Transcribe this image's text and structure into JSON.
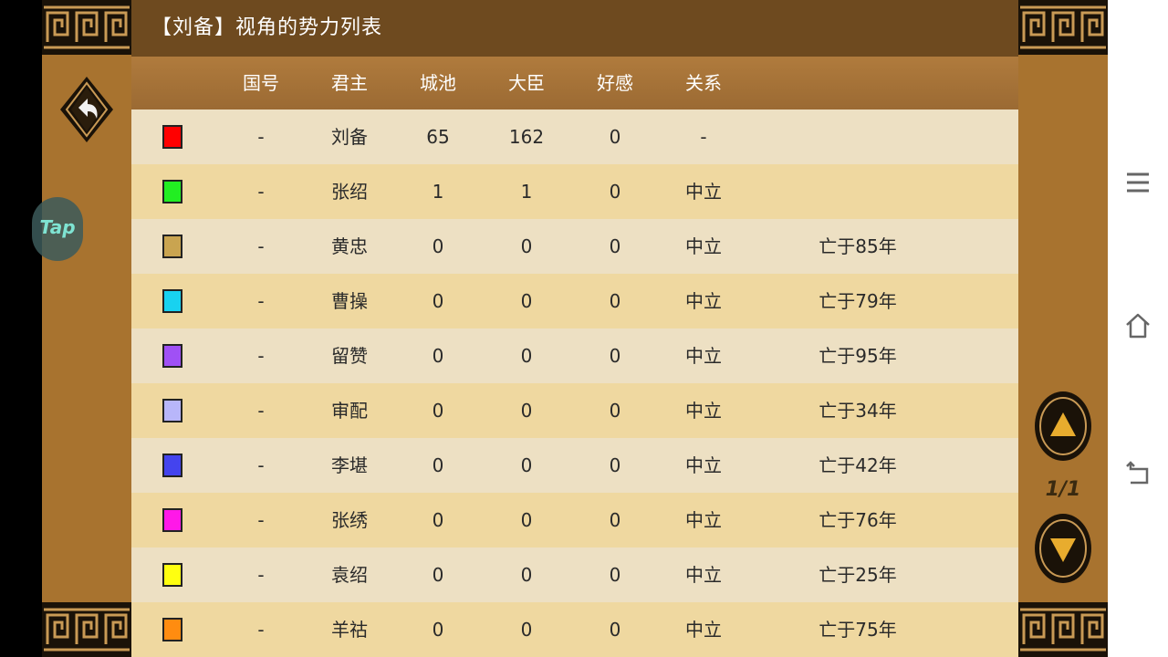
{
  "title": "【刘备】视角的势力列表",
  "columns": [
    "国号",
    "君主",
    "城池",
    "大臣",
    "好感",
    "关系"
  ],
  "rows": [
    {
      "color": "#ff0000",
      "country": "-",
      "ruler": "刘备",
      "cities": "65",
      "ministers": "162",
      "favor": "0",
      "relation": "-",
      "status": ""
    },
    {
      "color": "#22ee22",
      "country": "-",
      "ruler": "张绍",
      "cities": "1",
      "ministers": "1",
      "favor": "0",
      "relation": "中立",
      "status": ""
    },
    {
      "color": "#c9a450",
      "country": "-",
      "ruler": "黄忠",
      "cities": "0",
      "ministers": "0",
      "favor": "0",
      "relation": "中立",
      "status": "亡于85年"
    },
    {
      "color": "#18d2f0",
      "country": "-",
      "ruler": "曹操",
      "cities": "0",
      "ministers": "0",
      "favor": "0",
      "relation": "中立",
      "status": "亡于79年"
    },
    {
      "color": "#a050f5",
      "country": "-",
      "ruler": "留赞",
      "cities": "0",
      "ministers": "0",
      "favor": "0",
      "relation": "中立",
      "status": "亡于95年"
    },
    {
      "color": "#b8b6fa",
      "country": "-",
      "ruler": "审配",
      "cities": "0",
      "ministers": "0",
      "favor": "0",
      "relation": "中立",
      "status": "亡于34年"
    },
    {
      "color": "#4444ee",
      "country": "-",
      "ruler": "李堪",
      "cities": "0",
      "ministers": "0",
      "favor": "0",
      "relation": "中立",
      "status": "亡于42年"
    },
    {
      "color": "#ff18e8",
      "country": "-",
      "ruler": "张绣",
      "cities": "0",
      "ministers": "0",
      "favor": "0",
      "relation": "中立",
      "status": "亡于76年"
    },
    {
      "color": "#ffff10",
      "country": "-",
      "ruler": "袁绍",
      "cities": "0",
      "ministers": "0",
      "favor": "0",
      "relation": "中立",
      "status": "亡于25年"
    },
    {
      "color": "#ff8c10",
      "country": "-",
      "ruler": "羊祜",
      "cities": "0",
      "ministers": "0",
      "favor": "0",
      "relation": "中立",
      "status": "亡于75年"
    }
  ],
  "tap_label": "Tap",
  "page_indicator": "1/1",
  "icons": {
    "back": "back-arrow-icon",
    "page_up": "triangle-up-icon",
    "page_down": "triangle-down-icon",
    "nav_menu": "menu-icon",
    "nav_home": "home-icon",
    "nav_back": "return-icon"
  }
}
